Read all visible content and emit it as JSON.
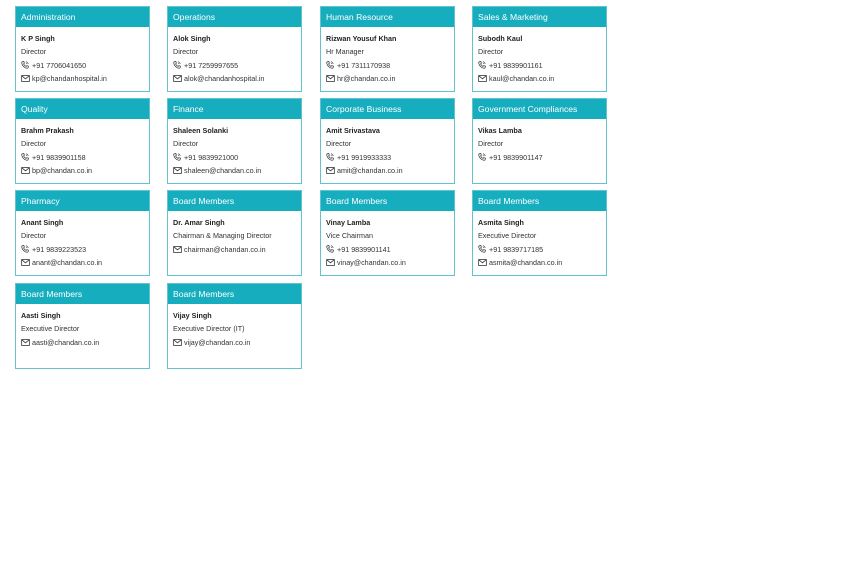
{
  "cards": [
    {
      "title": "Administration",
      "name": "K P Singh",
      "role": "Director",
      "phone": "+91 7706041650",
      "email": "kp@chandanhospital.in"
    },
    {
      "title": "Operations",
      "name": "Alok Singh",
      "role": "Director",
      "phone": "+91 7259997655",
      "email": "alok@chandanhospital.in"
    },
    {
      "title": "Human Resource",
      "name": "Rizwan Yousuf Khan",
      "role": "Hr Manager",
      "phone": "+91 7311170938",
      "email": "hr@chandan.co.in"
    },
    {
      "title": "Sales & Marketing",
      "name": "Subodh Kaul",
      "role": "Director",
      "phone": "+91 9839901161",
      "email": "kaul@chandan.co.in"
    },
    {
      "title": "Quality",
      "name": "Brahm Prakash",
      "role": "Director",
      "phone": "+91 9839901158",
      "email": "bp@chandan.co.in"
    },
    {
      "title": "Finance",
      "name": "Shaleen Solanki",
      "role": "Director",
      "phone": "+91 9839921000",
      "email": "shaleen@chandan.co.in"
    },
    {
      "title": "Corporate Business",
      "name": "Amit Srivastava",
      "role": "Director",
      "phone": "+91 9919933333",
      "email": "amit@chandan.co.in"
    },
    {
      "title": "Government Compliances",
      "name": "Vikas Lamba",
      "role": "Director",
      "phone": "+91 9839901147",
      "email": ""
    },
    {
      "title": "Pharmacy",
      "name": "Anant Singh",
      "role": "Director",
      "phone": "+91 9839223523",
      "email": "anant@chandan.co.in"
    },
    {
      "title": "Board Members",
      "name": "Dr. Amar Singh",
      "role": "Chairman & Managing Director",
      "phone": "",
      "email": "chairman@chandan.co.in"
    },
    {
      "title": "Board Members",
      "name": "Vinay Lamba",
      "role": "Vice Chairman",
      "phone": "+91 9839901141",
      "email": "vinay@chandan.co.in"
    },
    {
      "title": "Board Members",
      "name": "Asmita Singh",
      "role": "Executive Director",
      "phone": "+91 9839717185",
      "email": "asmita@chandan.co.in"
    },
    {
      "title": "Board Members",
      "name": "Aasti Singh",
      "role": "Executive Director",
      "phone": "",
      "email": "aasti@chandan.co.in"
    },
    {
      "title": "Board Members",
      "name": "Vijay Singh",
      "role": "Executive Director (IT)",
      "phone": "",
      "email": "vijay@chandan.co.in"
    }
  ],
  "icons": {
    "phone": "phone-icon",
    "email": "envelope-icon"
  },
  "colors": {
    "header_bg": "#16aebe",
    "border": "#62c3cf"
  }
}
